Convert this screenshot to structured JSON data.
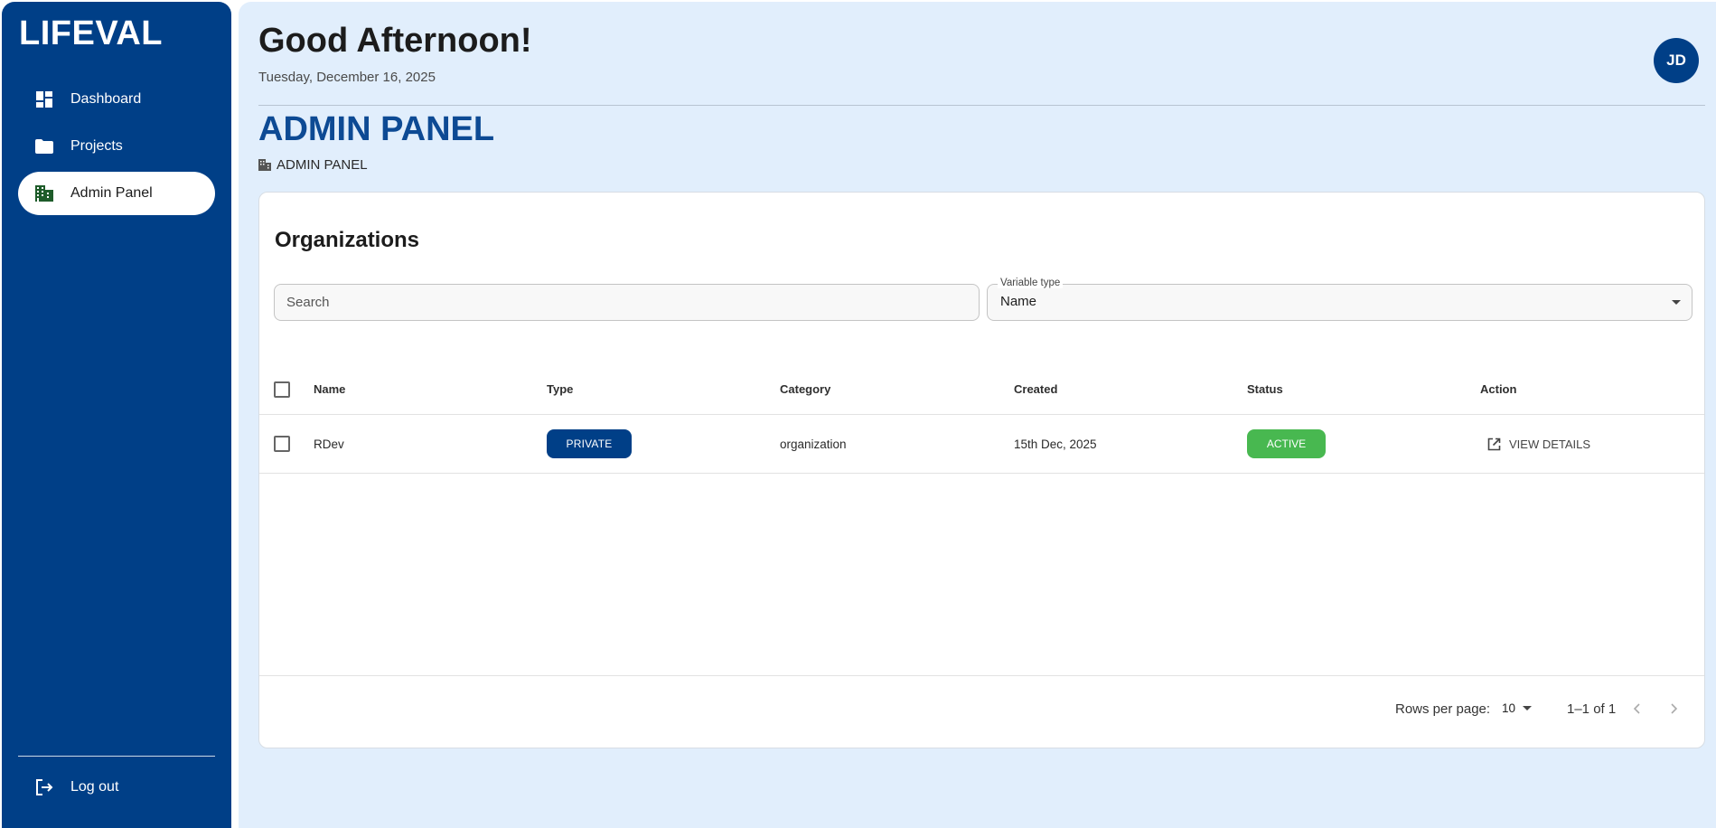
{
  "sidebar": {
    "logo": "LIFEVAL",
    "items": [
      {
        "label": "Dashboard",
        "icon": "dashboard-icon"
      },
      {
        "label": "Projects",
        "icon": "folder-icon"
      },
      {
        "label": "Admin Panel",
        "icon": "building-icon",
        "active": true
      }
    ],
    "logout_label": "Log out"
  },
  "header": {
    "greeting": "Good Afternoon!",
    "date": "Tuesday, December 16, 2025",
    "avatar_initials": "JD"
  },
  "page": {
    "title": "ADMIN PANEL",
    "breadcrumb": "ADMIN PANEL"
  },
  "card": {
    "title": "Organizations",
    "search": {
      "placeholder": "Search",
      "value": ""
    },
    "filter": {
      "label": "Variable type",
      "value": "Name"
    },
    "table": {
      "columns": [
        "Name",
        "Type",
        "Category",
        "Created",
        "Status",
        "Action"
      ],
      "rows": [
        {
          "name": "RDev",
          "type": "PRIVATE",
          "category": "organization",
          "created": "15th Dec, 2025",
          "status": "ACTIVE",
          "action": "VIEW DETAILS"
        }
      ]
    },
    "pagination": {
      "rows_per_page_label": "Rows per page:",
      "rows_per_page": "10",
      "range": "1–1 of 1"
    }
  },
  "colors": {
    "brand": "#003f87",
    "background": "#e1eefc",
    "active_status": "#48b850"
  }
}
